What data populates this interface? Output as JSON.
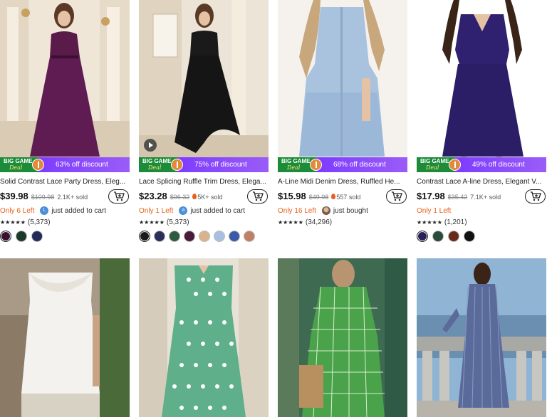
{
  "products": [
    {
      "title": "Solid Contrast Lace Party Dress, Eleg...",
      "discount": "63% off discount",
      "price": "$39.98",
      "original_price": "$109.98",
      "sold": "2.1K+ sold",
      "stock_left": "Only 6 Left",
      "avatar_letter": "L",
      "status_text": "just added to cart",
      "stars": "★★★★★",
      "rating_count": "(5,373)",
      "colors": [
        "#3a1030",
        "#1c3a2a",
        "#232a5a"
      ]
    },
    {
      "title": "Lace Splicing Ruffle Trim Dress, Elega...",
      "discount": "75% off discount",
      "price": "$23.28",
      "original_price": "$96.32",
      "sold": "5K+ sold",
      "stock_left": "Only 1 Left",
      "avatar_letter": "a",
      "status_text": "just added to cart",
      "stars": "★★★★★",
      "rating_count": "(5,373)",
      "colors": [
        "#1a1a1a",
        "#2a2f5a",
        "#2e5a3e",
        "#4a1a3a",
        "#d8b48e",
        "#a8c0e0",
        "#3a5aa8",
        "#c08068"
      ]
    },
    {
      "title": "A-Line Midi Denim Dress, Ruffled He...",
      "discount": "68% off discount",
      "price": "$15.98",
      "original_price": "$49.98",
      "sold": "557 sold",
      "stock_left": "Only 16 Left",
      "status_text": "just bought",
      "stars": "★★★★★",
      "rating_count": "(34,296)",
      "colors": []
    },
    {
      "title": "Contrast Lace A-line Dress, Elegant V...",
      "discount": "49% off discount",
      "price": "$17.98",
      "original_price": "$35.42",
      "sold": "7.1K+ sold",
      "stock_left": "Only 1 Left",
      "stars": "★★★★★",
      "rating_count": "(1,201)",
      "colors": [
        "#2a1f5a",
        "#2a4a3a",
        "#6a2a1a",
        "#111111"
      ]
    }
  ],
  "big_game_label": "BIG GAME",
  "deal_label": "Deal"
}
